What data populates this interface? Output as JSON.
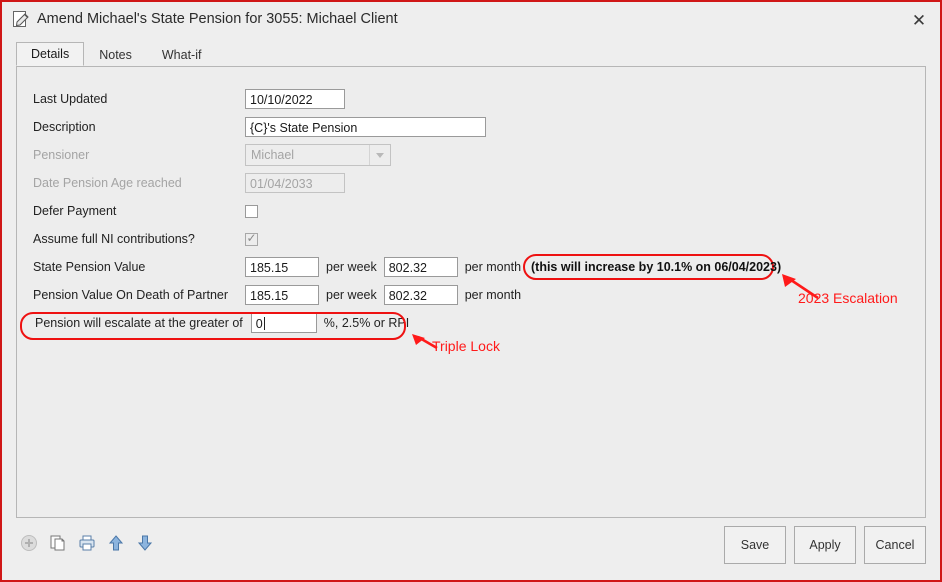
{
  "window": {
    "title": "Amend Michael's State Pension for 3055: Michael Client",
    "title_icon": "edit-document-icon",
    "close_icon": "✕",
    "border_color": "#d01717"
  },
  "tabs": [
    {
      "label": "Details",
      "active": true
    },
    {
      "label": "Notes",
      "active": false
    },
    {
      "label": "What-if",
      "active": false
    }
  ],
  "form": {
    "last_updated": {
      "label": "Last Updated",
      "value": "10/10/2022"
    },
    "description": {
      "label": "Description",
      "value": "{C}'s State Pension"
    },
    "pensioner": {
      "label": "Pensioner",
      "value": "Michael",
      "disabled": true
    },
    "date_pension_age": {
      "label": "Date Pension Age reached",
      "value": "01/04/2033",
      "disabled": true
    },
    "defer_payment": {
      "label": "Defer Payment",
      "checked": false
    },
    "assume_full_ni": {
      "label": "Assume full NI contributions?",
      "checked": true
    },
    "state_pension_value": {
      "label": "State Pension Value",
      "weekly": "185.15",
      "monthly": "802.32",
      "per_week_label": "per week",
      "per_month_label": "per month"
    },
    "pension_on_death": {
      "label": "Pension Value On Death of Partner",
      "weekly": "185.15",
      "monthly": "802.32",
      "per_week_label": "per week",
      "per_month_label": "per month"
    },
    "escalation": {
      "prefix": "Pension will escalate at the greater of",
      "value": "0",
      "suffix": "%, 2.5% or RPI"
    }
  },
  "annotations": {
    "escalation_notice": "(this will increase by 10.1% on 06/04/2023)",
    "label_2023_escalation": "2023 Escalation",
    "label_triple_lock": "Triple Lock",
    "color": "#ff1a1a"
  },
  "toolbar": {
    "icons": [
      {
        "name": "add-icon",
        "disabled": true
      },
      {
        "name": "copy-icon",
        "disabled": false
      },
      {
        "name": "print-icon",
        "disabled": false
      },
      {
        "name": "move-up-icon",
        "disabled": false
      },
      {
        "name": "move-down-icon",
        "disabled": false
      }
    ]
  },
  "buttons": {
    "save": "Save",
    "apply": "Apply",
    "cancel": "Cancel"
  }
}
